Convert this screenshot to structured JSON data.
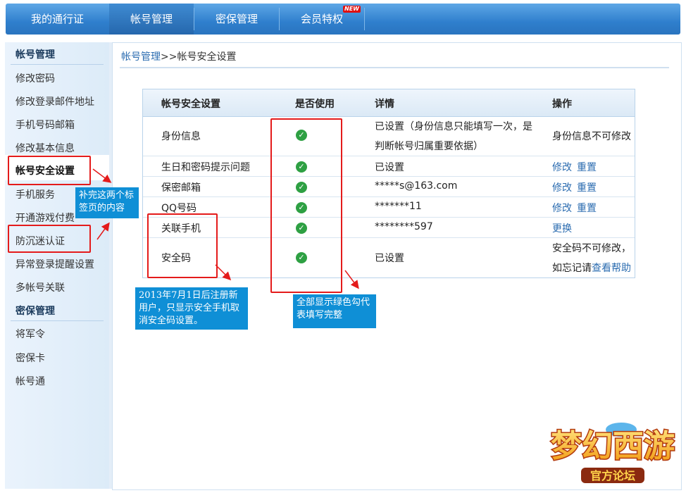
{
  "nav": {
    "tabs": [
      {
        "label": "我的通行证"
      },
      {
        "label": "帐号管理"
      },
      {
        "label": "密保管理"
      },
      {
        "label": "会员特权"
      }
    ],
    "new_badge": "NEW"
  },
  "sidebar": {
    "account_header": "帐号管理",
    "account_items": [
      "修改密码",
      "修改登录邮件地址",
      "手机号码邮箱",
      "修改基本信息",
      "帐号安全设置",
      "手机服务",
      "开通游戏付费",
      "防沉迷认证",
      "异常登录提醒设置",
      "多帐号关联"
    ],
    "security_header": "密保管理",
    "security_items": [
      "将军令",
      "密保卡",
      "帐号通"
    ]
  },
  "breadcrumb": {
    "link": "帐号管理",
    "sep": ">>",
    "current": "帐号安全设置"
  },
  "table": {
    "headers": [
      "帐号安全设置",
      "是否使用",
      "详情",
      "操作"
    ],
    "rows": [
      {
        "name": "身份信息",
        "detail1": "已设置（身份信息只能填写一次，是",
        "detail2": "判断帐号归属重要依据）",
        "op": "身份信息不可修改"
      },
      {
        "name": "生日和密码提示问题",
        "detail": "已设置",
        "op1": "修改",
        "op2": "重置"
      },
      {
        "name": "保密邮箱",
        "detail": "*****s@163.com",
        "op1": "修改",
        "op2": "重置"
      },
      {
        "name": "QQ号码",
        "detail": "*******11",
        "op1": "修改",
        "op2": "重置"
      },
      {
        "name": "关联手机",
        "detail": "********597",
        "op1": "更换"
      },
      {
        "name": "安全码",
        "detail": "已设置",
        "op_line1": "安全码不可修改，",
        "op_line2_text": "如忘记请",
        "op_line2_link": "查看帮助"
      }
    ]
  },
  "notes": {
    "tabs_note": "补完这两个标签页的内容",
    "register_note": "2013年7月1日后注册新用户，只显示安全手机取消安全码设置。",
    "green_note": "全部显示绿色勾代表填写完整"
  },
  "logo": {
    "title": "梦幻西游",
    "subtitle": "官方论坛"
  },
  "colors": {
    "nav_blue": "#2f7fcd",
    "link_blue": "#2b6cb0",
    "check_green": "#2ea043",
    "annotation_red": "#e41b1b",
    "note_blue": "#0f8fd6"
  }
}
